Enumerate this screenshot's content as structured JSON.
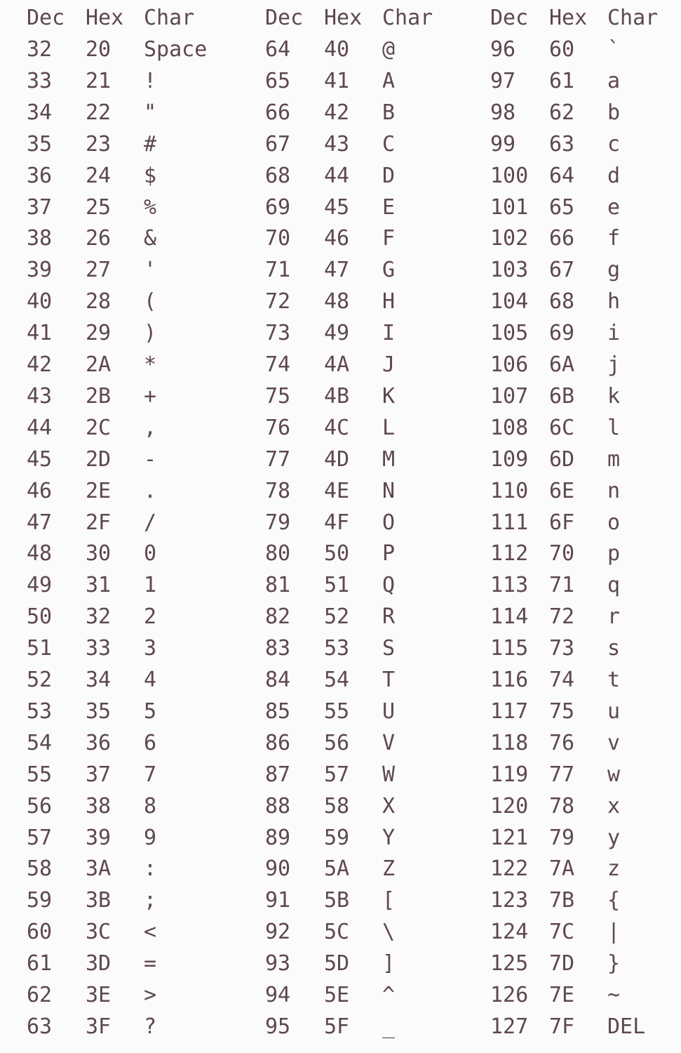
{
  "table": {
    "headers": [
      {
        "dec": "Dec",
        "hex": "Hex",
        "char": "Char"
      },
      {
        "dec": "Dec",
        "hex": "Hex",
        "char": "Char"
      },
      {
        "dec": "Dec",
        "hex": "Hex",
        "char": "Char"
      }
    ],
    "groups": [
      {
        "rows": [
          {
            "dec": "32",
            "hex": "20",
            "char": "Space"
          },
          {
            "dec": "33",
            "hex": "21",
            "char": "!"
          },
          {
            "dec": "34",
            "hex": "22",
            "char": "\""
          },
          {
            "dec": "35",
            "hex": "23",
            "char": "#"
          },
          {
            "dec": "36",
            "hex": "24",
            "char": "$"
          },
          {
            "dec": "37",
            "hex": "25",
            "char": "%"
          },
          {
            "dec": "38",
            "hex": "26",
            "char": "&"
          },
          {
            "dec": "39",
            "hex": "27",
            "char": "'"
          },
          {
            "dec": "40",
            "hex": "28",
            "char": "("
          },
          {
            "dec": "41",
            "hex": "29",
            "char": ")"
          },
          {
            "dec": "42",
            "hex": "2A",
            "char": "*"
          },
          {
            "dec": "43",
            "hex": "2B",
            "char": "+"
          },
          {
            "dec": "44",
            "hex": "2C",
            "char": ","
          },
          {
            "dec": "45",
            "hex": "2D",
            "char": "-"
          },
          {
            "dec": "46",
            "hex": "2E",
            "char": "."
          },
          {
            "dec": "47",
            "hex": "2F",
            "char": "/"
          },
          {
            "dec": "48",
            "hex": "30",
            "char": "0"
          },
          {
            "dec": "49",
            "hex": "31",
            "char": "1"
          },
          {
            "dec": "50",
            "hex": "32",
            "char": "2"
          },
          {
            "dec": "51",
            "hex": "33",
            "char": "3"
          },
          {
            "dec": "52",
            "hex": "34",
            "char": "4"
          },
          {
            "dec": "53",
            "hex": "35",
            "char": "5"
          },
          {
            "dec": "54",
            "hex": "36",
            "char": "6"
          },
          {
            "dec": "55",
            "hex": "37",
            "char": "7"
          },
          {
            "dec": "56",
            "hex": "38",
            "char": "8"
          },
          {
            "dec": "57",
            "hex": "39",
            "char": "9"
          },
          {
            "dec": "58",
            "hex": "3A",
            "char": ":"
          },
          {
            "dec": "59",
            "hex": "3B",
            "char": ";"
          },
          {
            "dec": "60",
            "hex": "3C",
            "char": "<"
          },
          {
            "dec": "61",
            "hex": "3D",
            "char": "="
          },
          {
            "dec": "62",
            "hex": "3E",
            "char": ">"
          },
          {
            "dec": "63",
            "hex": "3F",
            "char": "?"
          }
        ]
      },
      {
        "rows": [
          {
            "dec": "64",
            "hex": "40",
            "char": "@"
          },
          {
            "dec": "65",
            "hex": "41",
            "char": "A"
          },
          {
            "dec": "66",
            "hex": "42",
            "char": "B"
          },
          {
            "dec": "67",
            "hex": "43",
            "char": "C"
          },
          {
            "dec": "68",
            "hex": "44",
            "char": "D"
          },
          {
            "dec": "69",
            "hex": "45",
            "char": "E"
          },
          {
            "dec": "70",
            "hex": "46",
            "char": "F"
          },
          {
            "dec": "71",
            "hex": "47",
            "char": "G"
          },
          {
            "dec": "72",
            "hex": "48",
            "char": "H"
          },
          {
            "dec": "73",
            "hex": "49",
            "char": "I"
          },
          {
            "dec": "74",
            "hex": "4A",
            "char": "J"
          },
          {
            "dec": "75",
            "hex": "4B",
            "char": "K"
          },
          {
            "dec": "76",
            "hex": "4C",
            "char": "L"
          },
          {
            "dec": "77",
            "hex": "4D",
            "char": "M"
          },
          {
            "dec": "78",
            "hex": "4E",
            "char": "N"
          },
          {
            "dec": "79",
            "hex": "4F",
            "char": "O"
          },
          {
            "dec": "80",
            "hex": "50",
            "char": "P"
          },
          {
            "dec": "81",
            "hex": "51",
            "char": "Q"
          },
          {
            "dec": "82",
            "hex": "52",
            "char": "R"
          },
          {
            "dec": "83",
            "hex": "53",
            "char": "S"
          },
          {
            "dec": "84",
            "hex": "54",
            "char": "T"
          },
          {
            "dec": "85",
            "hex": "55",
            "char": "U"
          },
          {
            "dec": "86",
            "hex": "56",
            "char": "V"
          },
          {
            "dec": "87",
            "hex": "57",
            "char": "W"
          },
          {
            "dec": "88",
            "hex": "58",
            "char": "X"
          },
          {
            "dec": "89",
            "hex": "59",
            "char": "Y"
          },
          {
            "dec": "90",
            "hex": "5A",
            "char": "Z"
          },
          {
            "dec": "91",
            "hex": "5B",
            "char": "["
          },
          {
            "dec": "92",
            "hex": "5C",
            "char": "\\"
          },
          {
            "dec": "93",
            "hex": "5D",
            "char": "]"
          },
          {
            "dec": "94",
            "hex": "5E",
            "char": "^"
          },
          {
            "dec": "95",
            "hex": "5F",
            "char": "_"
          }
        ]
      },
      {
        "rows": [
          {
            "dec": "96",
            "hex": "60",
            "char": "`"
          },
          {
            "dec": "97",
            "hex": "61",
            "char": "a"
          },
          {
            "dec": "98",
            "hex": "62",
            "char": "b"
          },
          {
            "dec": "99",
            "hex": "63",
            "char": "c"
          },
          {
            "dec": "100",
            "hex": "64",
            "char": "d"
          },
          {
            "dec": "101",
            "hex": "65",
            "char": "e"
          },
          {
            "dec": "102",
            "hex": "66",
            "char": "f"
          },
          {
            "dec": "103",
            "hex": "67",
            "char": "g"
          },
          {
            "dec": "104",
            "hex": "68",
            "char": "h"
          },
          {
            "dec": "105",
            "hex": "69",
            "char": "i"
          },
          {
            "dec": "106",
            "hex": "6A",
            "char": "j"
          },
          {
            "dec": "107",
            "hex": "6B",
            "char": "k"
          },
          {
            "dec": "108",
            "hex": "6C",
            "char": "l"
          },
          {
            "dec": "109",
            "hex": "6D",
            "char": "m"
          },
          {
            "dec": "110",
            "hex": "6E",
            "char": "n"
          },
          {
            "dec": "111",
            "hex": "6F",
            "char": "o"
          },
          {
            "dec": "112",
            "hex": "70",
            "char": "p"
          },
          {
            "dec": "113",
            "hex": "71",
            "char": "q"
          },
          {
            "dec": "114",
            "hex": "72",
            "char": "r"
          },
          {
            "dec": "115",
            "hex": "73",
            "char": "s"
          },
          {
            "dec": "116",
            "hex": "74",
            "char": "t"
          },
          {
            "dec": "117",
            "hex": "75",
            "char": "u"
          },
          {
            "dec": "118",
            "hex": "76",
            "char": "v"
          },
          {
            "dec": "119",
            "hex": "77",
            "char": "w"
          },
          {
            "dec": "120",
            "hex": "78",
            "char": "x"
          },
          {
            "dec": "121",
            "hex": "79",
            "char": "y"
          },
          {
            "dec": "122",
            "hex": "7A",
            "char": "z"
          },
          {
            "dec": "123",
            "hex": "7B",
            "char": "{"
          },
          {
            "dec": "124",
            "hex": "7C",
            "char": "|"
          },
          {
            "dec": "125",
            "hex": "7D",
            "char": "}"
          },
          {
            "dec": "126",
            "hex": "7E",
            "char": "~"
          },
          {
            "dec": "127",
            "hex": "7F",
            "char": "DEL"
          }
        ]
      }
    ]
  },
  "colors": {
    "text": "#5e4850",
    "background": "#fbfbfb"
  }
}
